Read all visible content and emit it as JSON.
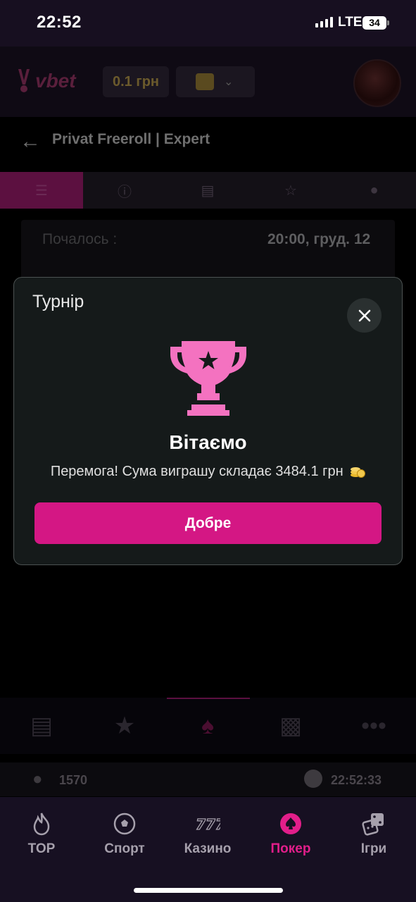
{
  "status_bar": {
    "time": "22:52",
    "network": "LTE",
    "battery": "34"
  },
  "header": {
    "logo": "vbet",
    "balance": "0.1 грн"
  },
  "page": {
    "title": "Privat Freeroll | Expert"
  },
  "tabs": [
    "list-icon",
    "info-icon",
    "calendar-icon",
    "trophy-icon",
    "user-icon"
  ],
  "info": {
    "started_label": "Почалось :",
    "started_value": "20:00, груд. 12"
  },
  "game_tabs": [
    "wallet-icon",
    "star-icon",
    "spade-icon",
    "podium-icon",
    "more-icon"
  ],
  "footer_stats": {
    "players": "1570",
    "clock": "22:52:33"
  },
  "modal": {
    "title": "Турнір",
    "heading": "Вітаємо",
    "message": "Перемога! Сума виграшу складає 3484.1 грн",
    "button": "Добре"
  },
  "bottom_nav": [
    {
      "label": "TOP",
      "icon": "flame-icon"
    },
    {
      "label": "Спорт",
      "icon": "soccer-ball-icon"
    },
    {
      "label": "Казино",
      "icon": "slot-777-icon"
    },
    {
      "label": "Покер",
      "icon": "poker-chip-icon",
      "active": true
    },
    {
      "label": "Ігри",
      "icon": "dice-icon"
    }
  ],
  "colors": {
    "accent": "#d41784",
    "active_nav": "#e21e8a",
    "trophy": "#f472c0",
    "modal_bg": "#151a1a"
  }
}
